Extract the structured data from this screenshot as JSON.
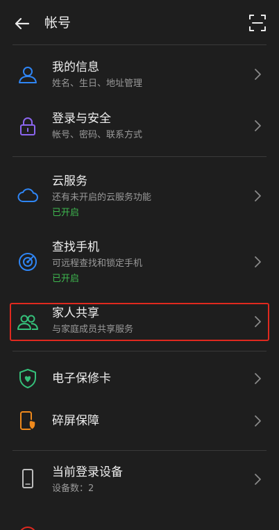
{
  "header": {
    "title": "帐号"
  },
  "items": [
    {
      "title": "我的信息",
      "subtitle": "姓名、生日、地址管理",
      "icon": "person-icon"
    },
    {
      "title": "登录与安全",
      "subtitle": "帐号、密码、联系方式",
      "icon": "lock-icon"
    },
    {
      "title": "云服务",
      "subtitle": "还有未开启的云服务功能",
      "status": "已开启",
      "icon": "cloud-icon"
    },
    {
      "title": "查找手机",
      "subtitle": "可远程查找和锁定手机",
      "status": "已开启",
      "icon": "radar-icon"
    },
    {
      "title": "家人共享",
      "subtitle": "与家庭成员共享服务",
      "icon": "family-icon"
    },
    {
      "title": "电子保修卡",
      "icon": "shield-heart-icon"
    },
    {
      "title": "碎屏保障",
      "icon": "phone-shield-icon"
    },
    {
      "title": "当前登录设备",
      "subtitle": "设备数：2",
      "icon": "phone-icon"
    }
  ],
  "colors": {
    "background": "#1e1e1e",
    "status_green": "#3fb950",
    "highlight_red": "#e0291f",
    "icon_blue": "#2f86f6",
    "icon_purple": "#8c66f0",
    "icon_green": "#35c07a",
    "icon_orange": "#f08a1c"
  }
}
